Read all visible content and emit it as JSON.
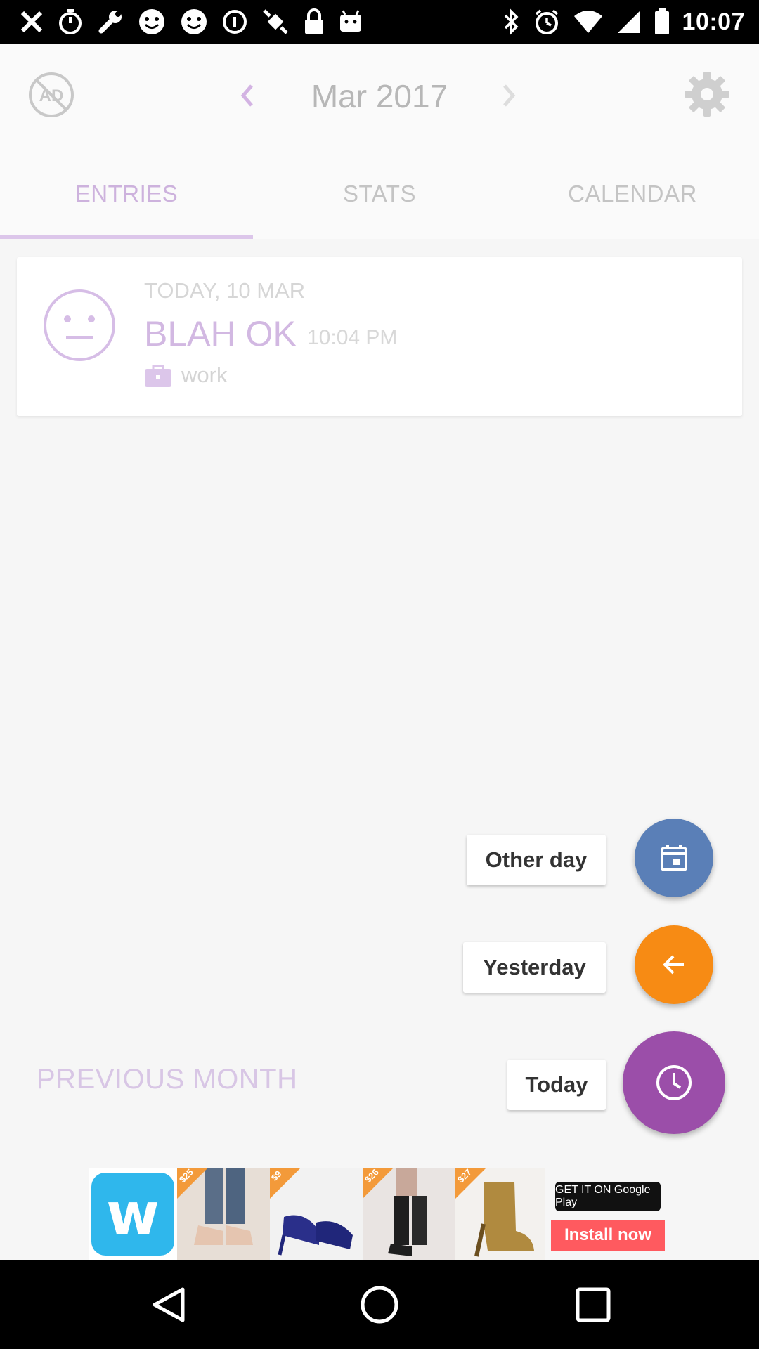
{
  "status_bar": {
    "time": "10:07",
    "left_icons": [
      "close-icon",
      "timer-icon",
      "wrench-icon",
      "smiley-icon",
      "smiley-icon",
      "info-icon",
      "fake-gps-icon",
      "lock-icon",
      "android-icon"
    ],
    "right_icons": [
      "bluetooth-icon",
      "alarm-icon",
      "wifi-icon",
      "signal-icon",
      "battery-icon"
    ]
  },
  "header": {
    "month_title": "Mar 2017",
    "noads_icon": "no-ads-icon",
    "settings_icon": "gear-icon"
  },
  "tabs": [
    {
      "label": "ENTRIES",
      "active": true
    },
    {
      "label": "STATS",
      "active": false
    },
    {
      "label": "CALENDAR",
      "active": false
    }
  ],
  "entry": {
    "date": "TODAY, 10 MAR",
    "mood": "BLAH OK",
    "time": "10:04 PM",
    "tag": "work"
  },
  "fabs": {
    "other_day": "Other day",
    "yesterday": "Yesterday",
    "today": "Today"
  },
  "previous_month": "PREVIOUS MONTH",
  "ad": {
    "brand_letter": "w",
    "prices": [
      "$25",
      "$9",
      "$26",
      "$27"
    ],
    "store_badge": "GET IT ON Google Play",
    "cta": "Install now"
  },
  "colors": {
    "accent": "#cdb2dd",
    "fab_blue": "#5a7fb7",
    "fab_orange": "#f78b14",
    "fab_purple": "#9b4ea9"
  }
}
